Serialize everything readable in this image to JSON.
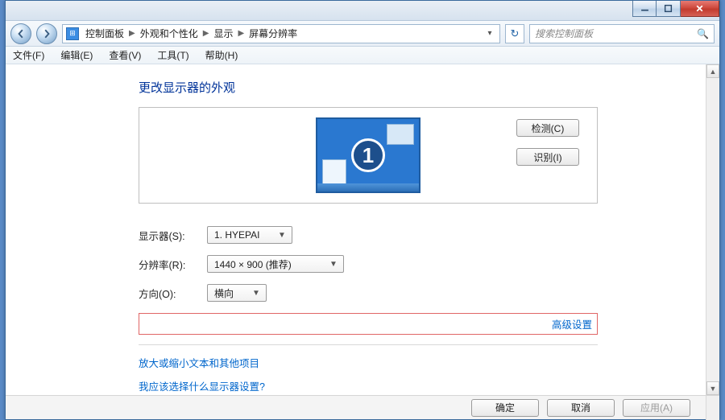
{
  "titlebar": {},
  "nav": {
    "crumbs": [
      "控制面板",
      "外观和个性化",
      "显示",
      "屏幕分辨率"
    ],
    "search_placeholder": "搜索控制面板"
  },
  "menu": {
    "file": "文件(F)",
    "edit": "编辑(E)",
    "view": "查看(V)",
    "tools": "工具(T)",
    "help": "帮助(H)"
  },
  "page": {
    "heading": "更改显示器的外观",
    "monitor_number": "1",
    "detect_btn": "检测(C)",
    "identify_btn": "识别(I)",
    "labels": {
      "display": "显示器(S):",
      "resolution": "分辨率(R):",
      "orientation": "方向(O):"
    },
    "values": {
      "display": "1. HYEPAI",
      "resolution": "1440 × 900 (推荐)",
      "orientation": "横向"
    },
    "advanced_link": "高级设置",
    "help1": "放大或缩小文本和其他项目",
    "help2": "我应该选择什么显示器设置?"
  },
  "footer": {
    "ok": "确定",
    "cancel": "取消",
    "apply": "应用(A)"
  }
}
